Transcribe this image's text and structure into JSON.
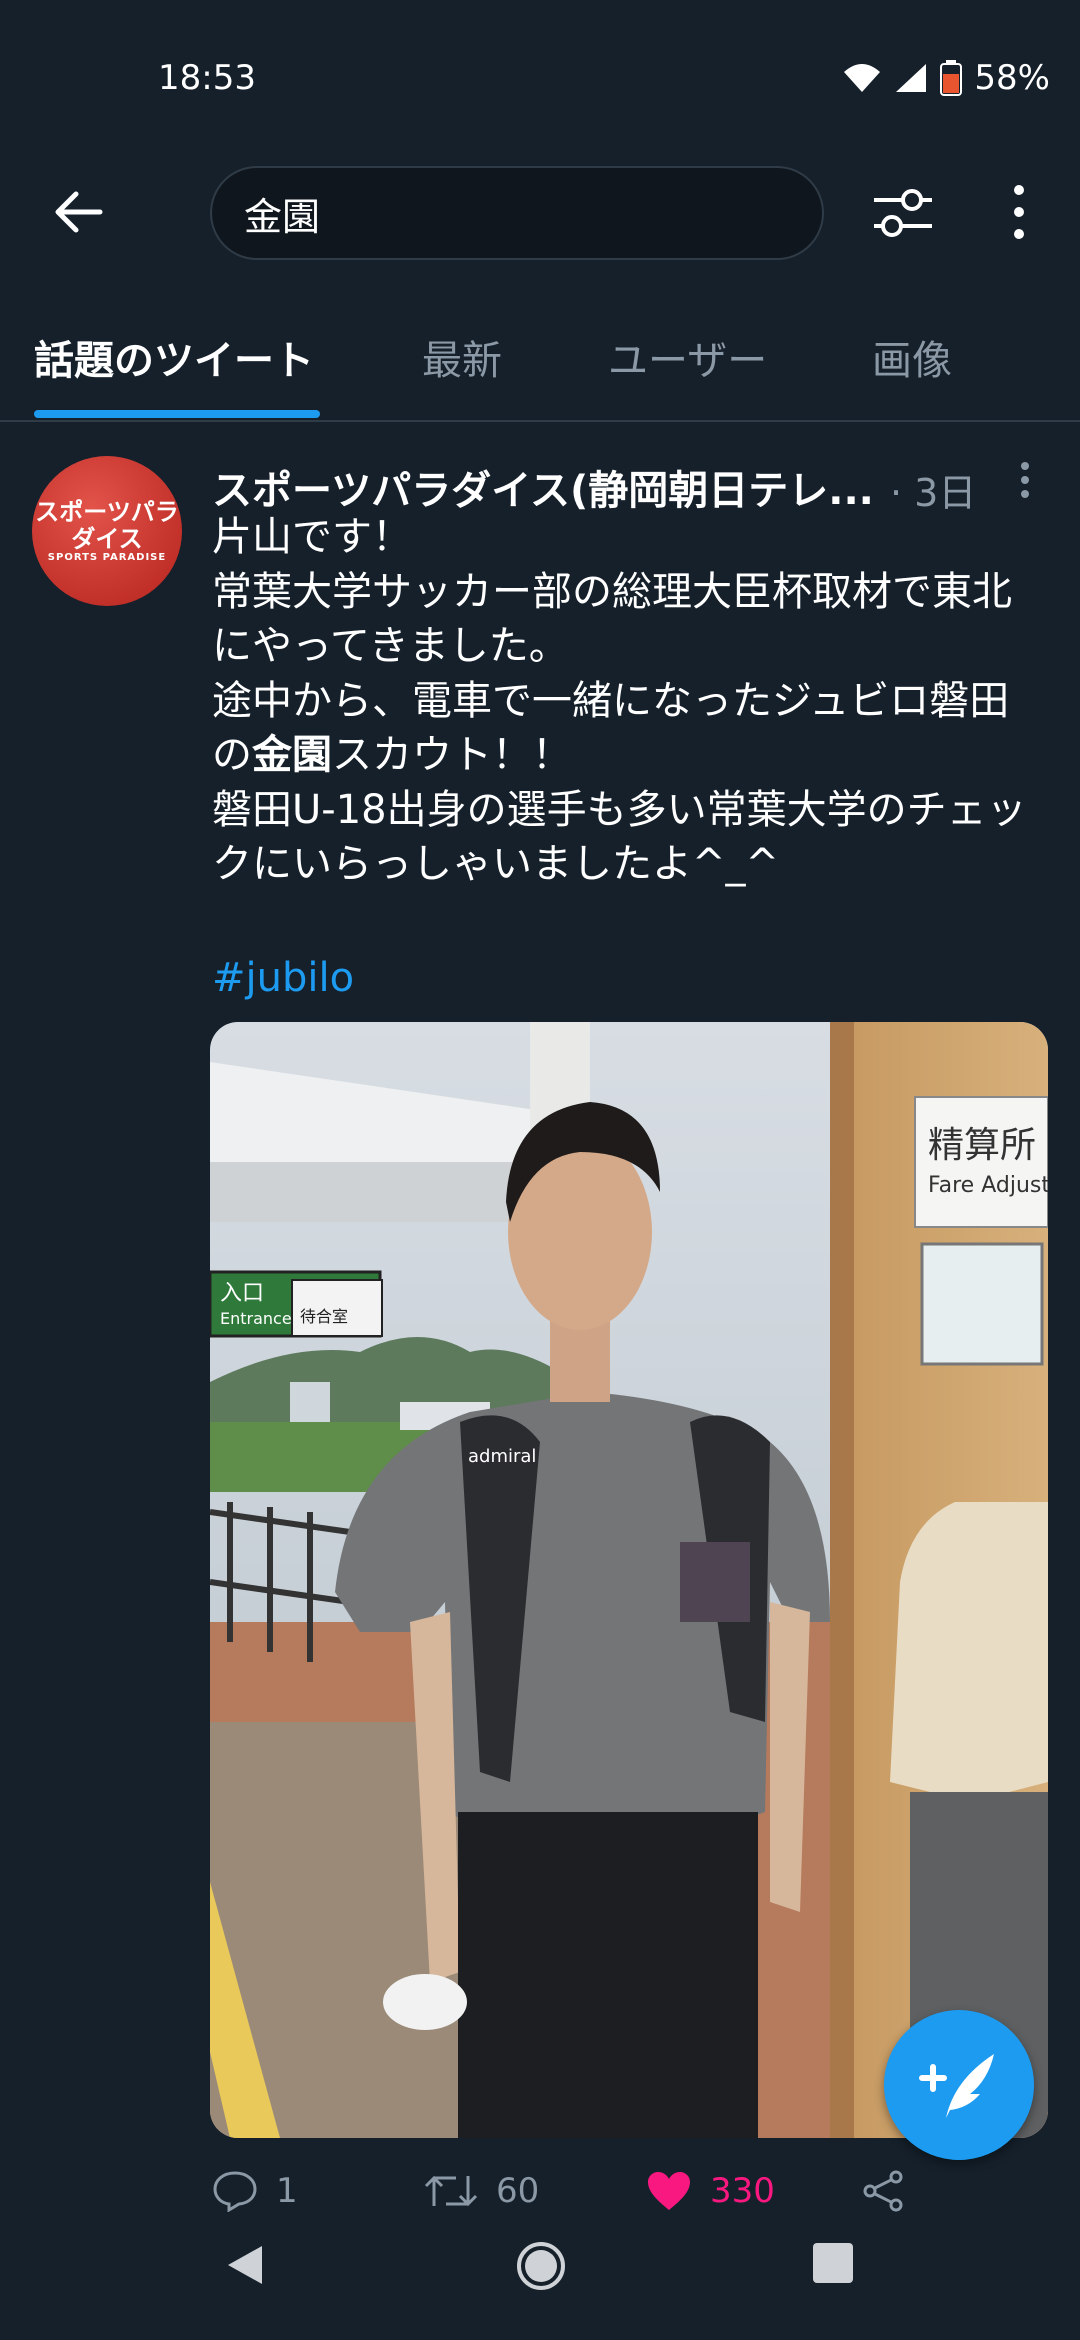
{
  "status_bar": {
    "time": "18:53",
    "battery": "58%"
  },
  "search": {
    "query": "金園"
  },
  "tabs": [
    {
      "label": "話題のツイート",
      "active": true
    },
    {
      "label": "最新",
      "active": false
    },
    {
      "label": "ユーザー",
      "active": false
    },
    {
      "label": "画像",
      "active": false
    }
  ],
  "tweet": {
    "author": "スポーツパラダイス(静岡朝日テレ...",
    "age": "· 3日",
    "avatar_text": "スポーツパラダイス",
    "avatar_subtext": "SPORTS PARADISE",
    "body_line1": "片山です！",
    "body_line2": "常葉大学サッカー部の総理大臣杯取材で東北にやってきました。",
    "body_line3_pre": "途中から、電車で一緒になったジュビロ磐田の",
    "body_line3_bold": "金園",
    "body_line3_post": "スカウト！！",
    "body_line4": "磐田U-18出身の選手も多い常葉大学のチェックにいらっしゃいましたよ^_^",
    "hashtag": "#jubilo",
    "photo_sign_text": "精算所",
    "photo_sign_subtext": "Fare Adjustm",
    "photo_sign_entrance": "入口",
    "photo_sign_entrance_en": "Entrance",
    "photo_sign_waiting": "待合室",
    "photo_shirt_brand": "admiral",
    "actions": {
      "replies": "1",
      "retweets": "60",
      "likes": "330"
    }
  },
  "colors": {
    "background": "#15202b",
    "accent": "#1d9bf0",
    "like": "#f91880",
    "muted": "#8b98a5"
  }
}
